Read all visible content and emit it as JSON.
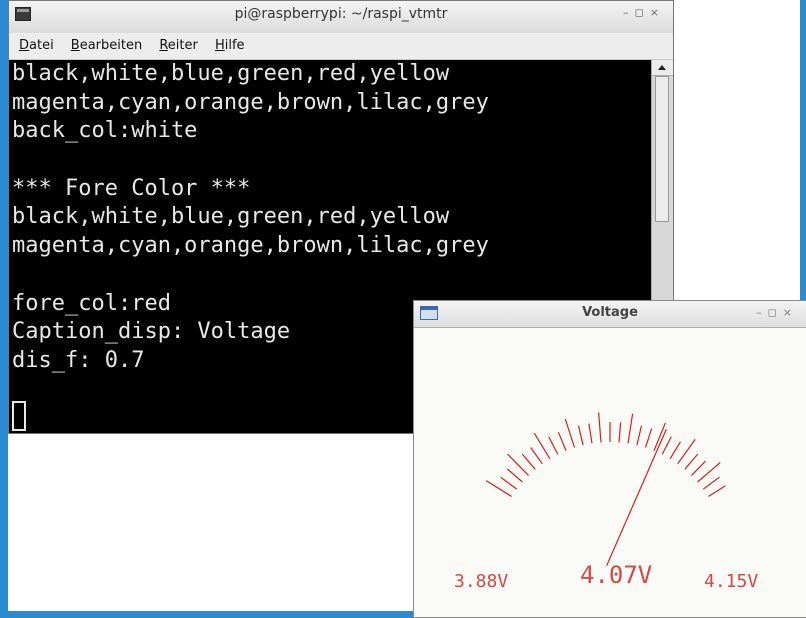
{
  "terminal": {
    "title": "pi@raspberrypi: ~/raspi_vtmtr",
    "controls": {
      "minimize": "–",
      "maximize": "◻",
      "close": "×"
    },
    "menu": [
      {
        "pre": "",
        "key": "D",
        "post": "atei"
      },
      {
        "pre": "",
        "key": "B",
        "post": "earbeiten"
      },
      {
        "pre": "",
        "key": "R",
        "post": "eiter"
      },
      {
        "pre": "",
        "key": "H",
        "post": "ilfe"
      }
    ],
    "lines": [
      "black,white,blue,green,red,yellow",
      "magenta,cyan,orange,brown,lilac,grey",
      "back_col:white",
      "",
      "*** Fore Color ***",
      "black,white,blue,green,red,yellow",
      "magenta,cyan,orange,brown,lilac,grey",
      "",
      "fore_col:red",
      "Caption_disp: Voltage",
      "dis_f: 0.7",
      ""
    ]
  },
  "voltage_window": {
    "title": "Voltage",
    "controls": {
      "minimize": "–",
      "maximize": "◻",
      "close": "×"
    },
    "meter": {
      "min_label": "3.88V",
      "current_label": "4.07V",
      "max_label": "4.15V",
      "min": 3.88,
      "max": 4.15,
      "value": 4.07,
      "needle_color": "#cc2222",
      "tick_color": "#cc2222",
      "text_color": "#d44848"
    }
  }
}
